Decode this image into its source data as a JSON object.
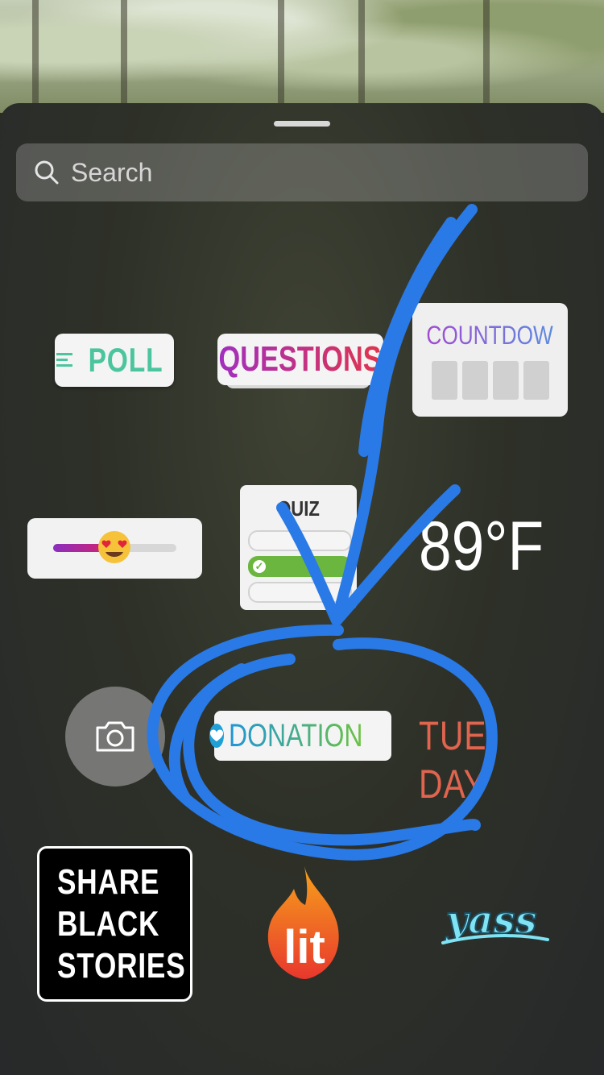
{
  "search": {
    "placeholder": "Search"
  },
  "stickers": {
    "poll": "POLL",
    "questions": "QUESTIONS",
    "countdown": "COUNTDOWN",
    "quiz": "QUIZ",
    "temperature": "89°F",
    "donation": "DONATION",
    "day": "TUE DAY",
    "share_black_stories": [
      "SHARE",
      "BLACK",
      "STORIES"
    ],
    "lit": "lit",
    "yass": "yass"
  },
  "slider": {
    "emoji": "heart-eyes-emoji",
    "value": 0.47
  },
  "colors": {
    "annotation": "#2979e6",
    "poll": "#4cc59e",
    "day": "#e0644e",
    "quiz_correct": "#6bb63e"
  }
}
